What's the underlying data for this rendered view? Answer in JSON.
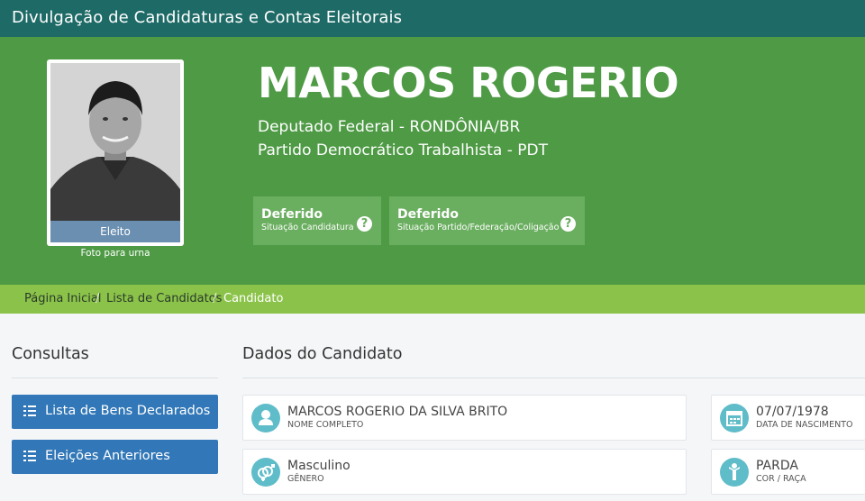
{
  "header": {
    "title": "Divulgação de Candidaturas e Contas Eleitorais"
  },
  "candidate": {
    "photo_status": "Eleito",
    "photo_caption": "Foto para urna",
    "name": "MARCOS ROGERIO",
    "office": "Deputado Federal - RONDÔNIA/BR",
    "party": "Partido Democrático Trabalhista - PDT"
  },
  "statuses": [
    {
      "title": "Deferido",
      "subtitle": "Situação Candidatura",
      "help": "?"
    },
    {
      "title": "Deferido",
      "subtitle": "Situação Partido/Federação/Coligação",
      "help": "?"
    }
  ],
  "breadcrumb": {
    "items": [
      "Página Inicial",
      "Lista de Candidatos",
      "Candidato"
    ],
    "separator": "/"
  },
  "sidebar": {
    "title": "Consultas",
    "buttons": [
      {
        "label": "Lista de Bens Declarados"
      },
      {
        "label": "Eleições Anteriores"
      }
    ]
  },
  "main": {
    "title": "Dados do Candidato",
    "fields": [
      {
        "value": "MARCOS ROGERIO DA SILVA BRITO",
        "label": "NOME COMPLETO",
        "icon": "user-icon"
      },
      {
        "value": "07/07/1978",
        "label": "DATA DE NASCIMENTO",
        "icon": "calendar-icon"
      },
      {
        "value": "Masculino",
        "label": "GÊNERO",
        "icon": "gender-icon"
      },
      {
        "value": "PARDA",
        "label": "COR / RAÇA",
        "icon": "person-icon"
      }
    ]
  },
  "colors": {
    "topbar": "#1e6a66",
    "hero": "#4e9a45",
    "breadcrumb": "#8bc34a",
    "button": "#3277b7",
    "icon_circle": "#5fbcc9"
  }
}
